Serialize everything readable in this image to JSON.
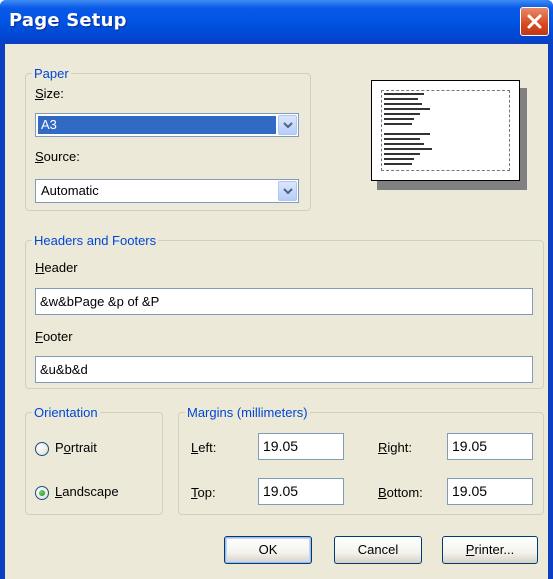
{
  "window": {
    "title": "Page Setup"
  },
  "paper": {
    "legend": "Paper",
    "size_label": "Size:",
    "size_value": "A3",
    "source_label": "Source:",
    "source_value": "Automatic"
  },
  "headers_footers": {
    "legend": "Headers and Footers",
    "header_label": "Header",
    "header_value": "&w&bPage &p of &P",
    "footer_label": "Footer",
    "footer_value": "&u&b&d"
  },
  "orientation": {
    "legend": "Orientation",
    "portrait_label": "Portrait",
    "landscape_label": "Landscape",
    "selected": "Landscape"
  },
  "margins": {
    "legend": "Margins (millimeters)",
    "left_label": "Left:",
    "left_value": "19.05",
    "right_label": "Right:",
    "right_value": "19.05",
    "top_label": "Top:",
    "top_value": "19.05",
    "bottom_label": "Bottom:",
    "bottom_value": "19.05"
  },
  "buttons": {
    "ok": "OK",
    "cancel": "Cancel",
    "printer": "Printer..."
  },
  "colors": {
    "titlebar": "#0054e3",
    "legend_text": "#0046d5",
    "selection": "#316ac5",
    "close": "#d8491e"
  },
  "icons": {
    "close": "close-x-icon",
    "dropdown": "chevron-down-icon"
  }
}
